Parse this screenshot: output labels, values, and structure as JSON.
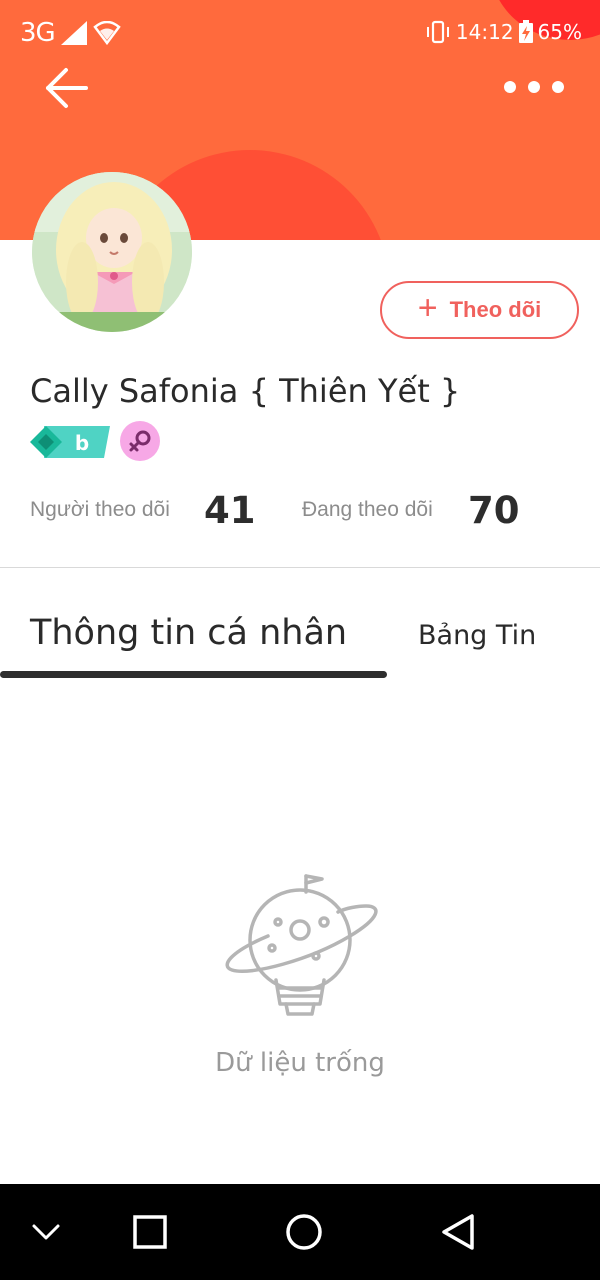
{
  "status_bar": {
    "network": "3G",
    "time": "14:12",
    "battery": "65%"
  },
  "header": {
    "back_icon": "arrow-left-icon",
    "more_icon": "more-horizontal-icon"
  },
  "profile": {
    "name": "Cally Safonia { Thiên Yết }",
    "follow_label": "Theo dõi",
    "level_badge": "b",
    "gender_icon": "female-icon"
  },
  "stats": {
    "followers_label": "Người theo dõi",
    "followers_value": "41",
    "following_label": "Đang theo dõi",
    "following_value": "70"
  },
  "tabs": [
    {
      "label": "Thông tin cá nhân",
      "active": true
    },
    {
      "label": "Bảng Tin",
      "active": false
    }
  ],
  "empty_state": {
    "icon": "planet-bulb-icon",
    "text": "Dữ liệu trống"
  },
  "colors": {
    "banner": "#ff6a3d",
    "accent": "#f0615d",
    "badge_teal": "#3fcfc0",
    "badge_pink": "#f7a8e6"
  },
  "nav": [
    "chevron-down-icon",
    "square-icon",
    "circle-icon",
    "triangle-back-icon"
  ]
}
